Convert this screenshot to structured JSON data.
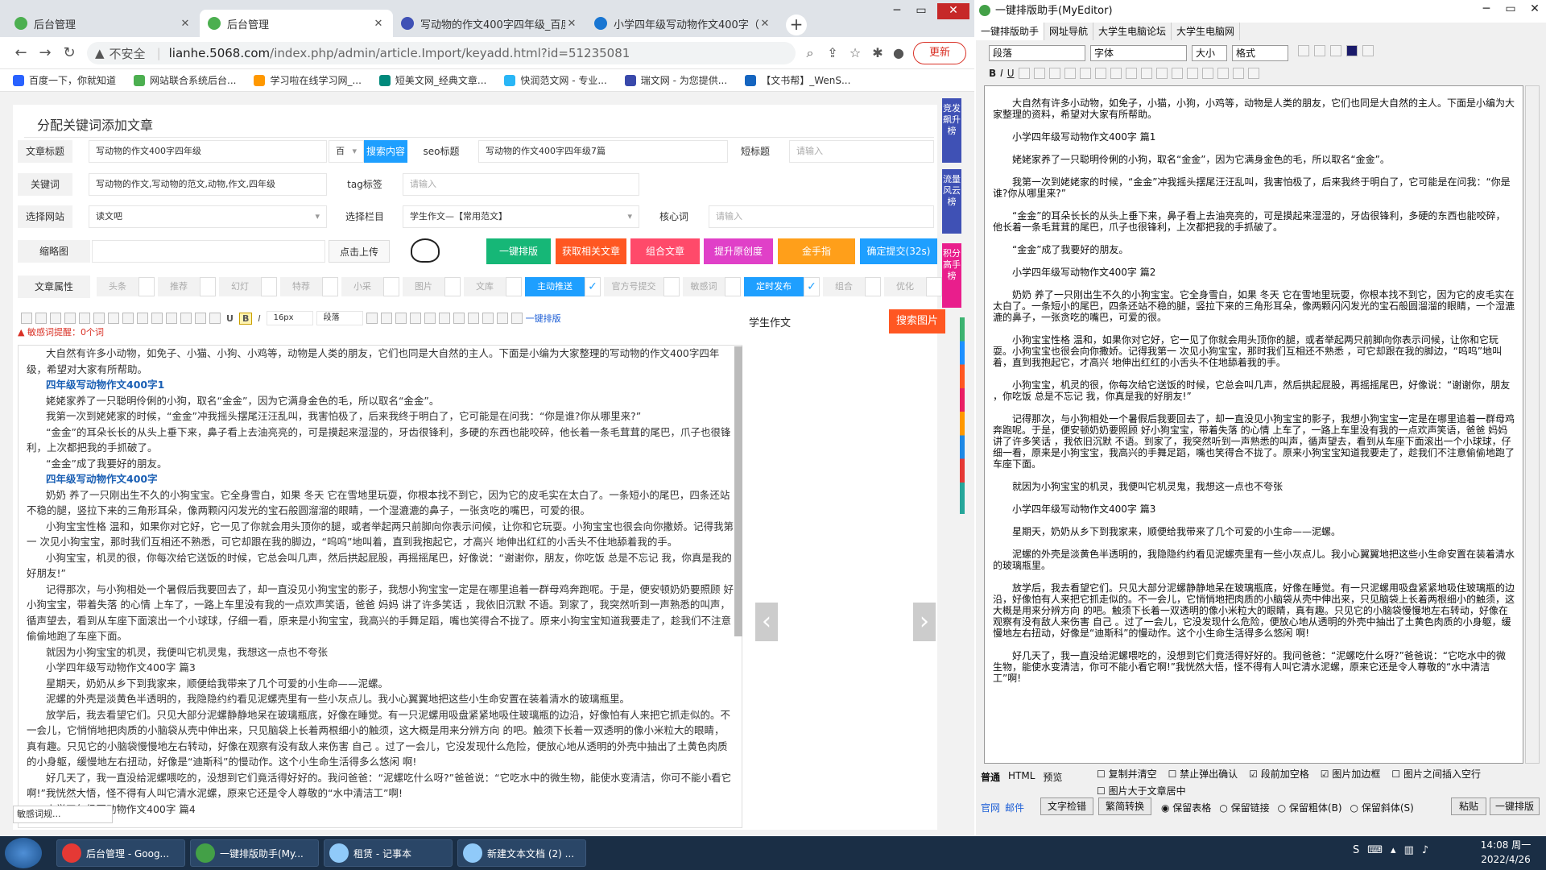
{
  "browser": {
    "tabs": [
      {
        "title": "后台管理",
        "favicon_color": "#4caf50"
      },
      {
        "title": "后台管理",
        "favicon_color": "#4caf50"
      },
      {
        "title": "写动物的作文400字四年级_百度",
        "favicon_color": "#3f51b5"
      },
      {
        "title": "小学四年级写动物作文400字（",
        "favicon_color": "#1976d2"
      }
    ],
    "new_tab": "+",
    "address": {
      "warning": "▲",
      "not_secure": "不安全",
      "host": "lianhe.5068.com",
      "path": "/index.php/admin/article.Import/keyadd.html?id=51235081"
    },
    "update_button": "更新",
    "bookmarks": [
      {
        "label": "百度一下，你就知道",
        "color": "#2962ff"
      },
      {
        "label": "网站联合系统后台...",
        "color": "#4caf50"
      },
      {
        "label": "学习啦在线学习网_...",
        "color": "#ff9800"
      },
      {
        "label": "短美文网_经典文章...",
        "color": "#00897b"
      },
      {
        "label": "快润范文网 - 专业...",
        "color": "#29b6f6"
      },
      {
        "label": "瑞文网 - 为您提供...",
        "color": "#3949ab"
      },
      {
        "label": "【文书帮】_WenS...",
        "color": "#1565c0"
      }
    ]
  },
  "form": {
    "page_title": "分配关键词添加文章",
    "fields": {
      "article_title_label": "文章标题",
      "article_title_value": "写动物的作文400字四年级",
      "article_title_type": "百",
      "search_button": "搜索内容",
      "seo_title_label": "seo标题",
      "seo_title_value": "写动物的作文400字四年级7篇",
      "short_title_label": "短标题",
      "short_title_placeholder": "请输入",
      "keywords_label": "关键词",
      "keywords_value": "写动物的作文,写动物的范文,动物,作文,四年级",
      "tag_label": "tag标签",
      "tag_placeholder": "请输入",
      "site_label": "选择网站",
      "site_value": "读文吧",
      "column_label": "选择栏目",
      "column_value": "学生作文—【常用范文】",
      "core_word_label": "核心词",
      "core_word_placeholder": "请输入",
      "thumbnail_label": "缩略图",
      "upload_button": "点击上传"
    },
    "action_buttons": [
      {
        "label": "一键排版",
        "color": "#16b777"
      },
      {
        "label": "获取相关文章",
        "color": "#ff5722"
      },
      {
        "label": "组合文章",
        "color": "#ff4a6a"
      },
      {
        "label": "提升原创度",
        "color": "#e040c8"
      },
      {
        "label": "金手指",
        "color": "#ff9f1a"
      },
      {
        "label": "确定提交(32s)",
        "color": "#1e9fff"
      }
    ],
    "attributes_label": "文章属性",
    "attributes": [
      {
        "label": "头条",
        "checked": false
      },
      {
        "label": "推荐",
        "checked": false
      },
      {
        "label": "幻灯",
        "checked": false
      },
      {
        "label": "特荐",
        "checked": false
      },
      {
        "label": "小采",
        "checked": false
      },
      {
        "label": "图片",
        "checked": false
      },
      {
        "label": "文库",
        "checked": false
      },
      {
        "label": "主动推送",
        "checked": true
      },
      {
        "label": "官方号提交",
        "checked": false
      },
      {
        "label": "敏感词",
        "checked": false
      },
      {
        "label": "定时发布",
        "checked": true
      },
      {
        "label": "组合",
        "checked": false
      },
      {
        "label": "优化",
        "checked": false
      }
    ]
  },
  "editor": {
    "font_size": "16px",
    "paragraph_format": "段落",
    "one_key_format": "一键排版",
    "sensitive_words": "敏感词提醒：0个词",
    "paragraphs": [
      {
        "text": "大自然有许多小动物，如免子、小猫、小狗、小鸡等，动物是人类的朋友，它们也同是大自然的主人。下面是小编为大家整理的写动物的作文400字四年级，希望对大家有所帮助。",
        "heading": false
      },
      {
        "text": "四年级写动物作文400字1",
        "heading": true
      },
      {
        "text": "姥姥家养了一只聪明伶俐的小狗，取名“金金”，因为它满身金色的毛，所以取名“金金”。",
        "heading": false
      },
      {
        "text": "我第一次到姥姥家的时候，“金金”冲我摇头摆尾汪汪乱叫，我害怕极了，后来我终于明白了，它可能是在问我：“你是谁?你从哪里来?”",
        "heading": false
      },
      {
        "text": "“金金”的耳朵长长的从头上垂下来，鼻子看上去油亮亮的，可是摸起来湿湿的，牙齿很锋利，多硬的东西也能咬碎，他长着一条毛茸茸的尾巴，爪子也很锋利，上次都把我的手抓破了。",
        "heading": false
      },
      {
        "text": "“金金”成了我要好的朋友。",
        "heading": false
      },
      {
        "text": "四年级写动物作文400字",
        "heading": true
      },
      {
        "text": "奶奶 养了一只刚出生不久的小狗宝宝。它全身雪白，如果 冬天 它在雪地里玩耍，你根本找不到它，因为它的皮毛实在太白了。一条短小的尾巴，四条还站不稳的腿，竖拉下来的三角形耳朵，像两颗闪闪发光的宝石般圆溜溜的眼睛，一个湿漉漉的鼻子，一张贪吃的嘴巴，可爱的很。",
        "heading": false
      },
      {
        "text": "小狗宝宝性格 温和，如果你对它好，它一见了你就会用头顶你的腿，或者举起两只前脚向你表示问候，让你和它玩耍。小狗宝宝也很会向你撒娇。记得我第一 次见小狗宝宝，那时我们互相还不熟悉，可它却跟在我的脚边，“呜呜”地叫着，直到我抱起它，才高兴 地伸出红红的小舌头不住地舔着我的手。",
        "heading": false
      },
      {
        "text": "小狗宝宝，机灵的很，你每次给它送饭的时候，它总会叫几声，然后拱起屁股，再摇摇尾巴，好像说：“谢谢你，朋友，你吃饭 总是不忘记 我，你真是我的好朋友!”",
        "heading": false
      },
      {
        "text": "记得那次，与小狗相处一个暑假后我要回去了，却一直没见小狗宝宝的影子，我想小狗宝宝一定是在哪里追着一群母鸡奔跑呢。于是，便安顿奶奶要照顾 好小狗宝宝，带着失落 的心情 上车了，一路上车里没有我的一点欢声笑语，爸爸 妈妈 讲了许多笑话 ，我依旧沉默 不语。到家了，我突然听到一声熟悉的叫声，循声望去，看到从车座下面滚出一个小球球，仔细一看，原来是小狗宝宝，我高兴的手舞足蹈，嘴也笑得合不拢了。原来小狗宝宝知道我要走了，趁我们不注意偷偷地跑了车座下面。",
        "heading": false
      },
      {
        "text": "就因为小狗宝宝的机灵，我便叫它机灵鬼，我想这一点也不夸张",
        "heading": false
      },
      {
        "text": "小学四年级写动物作文400字 篇3",
        "heading": false
      },
      {
        "text": "星期天，奶奶从乡下到我家来，顺便给我带来了几个可爱的小生命——泥螺。",
        "heading": false
      },
      {
        "text": "泥螺的外壳是淡黄色半透明的，我隐隐约约看见泥螺壳里有一些小灰点儿。我小心翼翼地把这些小生命安置在装着清水的玻璃瓶里。",
        "heading": false
      },
      {
        "text": "放学后，我去看望它们。只见大部分泥螺静静地呆在玻璃瓶底，好像在睡觉。有一只泥螺用吸盘紧紧地吸住玻璃瓶的边沿，好像怕有人来把它抓走似的。不一会儿，它悄悄地把肉质的小脑袋从壳中伸出来，只见脑袋上长着两根细小的触须，这大概是用来分辨方向 的吧。触须下长着一双透明的像小米粒大的眼睛，真有趣。只见它的小脑袋慢慢地左右转动，好像在观察有没有敌人来伤害 自己 。过了一会儿，它没发现什么危险，便放心地从透明的外壳中抽出了土黄色肉质的小身躯，缓慢地左右扭动，好像是“迪斯科”的慢动作。这个小生命生活得多么悠闲 啊!",
        "heading": false
      },
      {
        "text": "好几天了，我一直没给泥螺喂吃的，没想到它们竟活得好好的。我问爸爸：“泥螺吃什么呀?”爸爸说：“它吃水中的微生物，能使水变清洁，你可不能小看它啊!”我恍然大悟，怪不得有人叫它清水泥螺，原来它还是令人尊敬的“水中清洁工”啊!",
        "heading": false
      },
      {
        "text": "小学四年级写动物作文400字 篇4",
        "heading": false
      }
    ]
  },
  "side": {
    "title": "学生作文",
    "search_image_button": "搜索图片",
    "prev_arrow": "‹",
    "next_arrow": "›",
    "vertical_tabs": [
      {
        "label": "竞发飙升榜",
        "color": "#3f51b5"
      },
      {
        "label": "流量风云榜",
        "color": "#3f51b5"
      },
      {
        "label": "积分高手榜",
        "color": "#e91e8c"
      }
    ],
    "status_text": "敏感词规..."
  },
  "myeditor": {
    "title": "一键排版助手(MyEditor)",
    "menu": [
      "一键排版助手",
      "网址导航",
      "大学生电脑论坛",
      "大学生电脑网"
    ],
    "combos": {
      "format": "段落",
      "font": "字体",
      "size": "大小",
      "style": "格式"
    },
    "paragraphs": [
      "大自然有许多小动物，如免子，小猫，小狗，小鸡等，动物是人类的朋友，它们也同是大自然的主人。下面是小编为大家整理的资料，希望对大家有所帮助。",
      "小学四年级写动物作文400字 篇1",
      "姥姥家养了一只聪明伶俐的小狗，取名“金金”，因为它满身金色的毛，所以取名“金金”。",
      "我第一次到姥姥家的时候，“金金”冲我摇头摆尾汪汪乱叫，我害怕极了，后来我终于明白了，它可能是在问我：“你是谁?你从哪里来?”",
      "“金金”的耳朵长长的从头上垂下来，鼻子看上去油亮亮的，可是摸起来湿湿的，牙齿很锋利，多硬的东西也能咬碎，他长着一条毛茸茸的尾巴，爪子也很锋利，上次都把我的手抓破了。",
      "“金金”成了我要好的朋友。",
      "小学四年级写动物作文400字 篇2",
      "奶奶 养了一只刚出生不久的小狗宝宝。它全身雪白，如果 冬天 它在雪地里玩耍，你根本找不到它，因为它的皮毛实在太白了。一条短小的尾巴，四条还站不稳的腿，竖拉下来的三角形耳朵，像两颗闪闪发光的宝石般圆溜溜的眼睛，一个湿漉漉的鼻子，一张贪吃的嘴巴，可爱的很。",
      "小狗宝宝性格 温和，如果你对它好，它一见了你就会用头顶你的腿，或者举起两只前脚向你表示问候，让你和它玩耍。小狗宝宝也很会向你撒娇。记得我第一 次见小狗宝宝，那时我们互相还不熟悉 ，可它却跟在我的脚边，“呜呜”地叫着，直到我抱起它，才高兴 地伸出红红的小舌头不住地舔着我的手。",
      "小狗宝宝，机灵的很，你每次给它送饭的时候，它总会叫几声，然后拱起屁股，再摇摇尾巴，好像说：“谢谢你，朋友 ，你吃饭 总是不忘记 我，你真是我的好朋友!”",
      "记得那次，与小狗相处一个暑假后我要回去了，却一直没见小狗宝宝的影子，我想小狗宝宝一定是在哪里追着一群母鸡奔跑呢。于是，便安顿奶奶要照顾 好小狗宝宝，带着失落 的心情 上车了，一路上车里没有我的一点欢声笑语，爸爸 妈妈 讲了许多笑话 ，我依旧沉默 不语。到家了，我突然听到一声熟悉的叫声，循声望去，看到从车座下面滚出一个小球球，仔细一看，原来是小狗宝宝，我高兴的手舞足蹈，嘴也笑得合不拢了。原来小狗宝宝知道我要走了，趁我们不注意偷偷地跑了车座下面。",
      "就因为小狗宝宝的机灵，我便叫它机灵鬼，我想这一点也不夸张",
      "小学四年级写动物作文400字 篇3",
      "星期天，奶奶从乡下到我家来，顺便给我带来了几个可爱的小生命——泥螺。",
      "泥螺的外壳是淡黄色半透明的，我隐隐约约看见泥螺壳里有一些小灰点儿。我小心翼翼地把这些小生命安置在装着清水的玻璃瓶里。",
      "放学后，我去看望它们。只见大部分泥螺静静地呆在玻璃瓶底，好像在睡觉。有一只泥螺用吸盘紧紧地吸住玻璃瓶的边沿，好像怕有人来把它抓走似的。不一会儿，它悄悄地把肉质的小脑袋从壳中伸出来，只见脑袋上长着两根细小的触须，这大概是用来分辨方向 的吧。触须下长着一双透明的像小米粒大的眼睛，真有趣。只见它的小脑袋慢慢地左右转动，好像在观察有没有敌人来伤害 自己 。过了一会儿，它没发现什么危险，便放心地从透明的外壳中抽出了土黄色肉质的小身躯，缓慢地左右扭动，好像是“迪斯科”的慢动作。这个小生命生活得多么悠闲 啊!",
      "好几天了，我一直没给泥螺喂吃的，没想到它们竟活得好好的。我问爸爸：“泥螺吃什么呀?”爸爸说：“它吃水中的微生物，能使水变清洁，你可不能小看它啊!”我恍然大悟，怪不得有人叫它清水泥螺，原来它还是令人尊敬的“水中清洁工”啊!"
    ],
    "bottom": {
      "tabs": [
        "普通",
        "HTML",
        "预览"
      ],
      "checks": [
        {
          "label": "复制并清空",
          "checked": false
        },
        {
          "label": "禁止弹出确认",
          "checked": false
        },
        {
          "label": "段前加空格",
          "checked": true
        },
        {
          "label": "图片加边框",
          "checked": true
        },
        {
          "label": "图片之间插入空行",
          "checked": false
        },
        {
          "label": "图片大于文章居中",
          "checked": false
        }
      ],
      "links": [
        "官网",
        "邮件"
      ],
      "buttons": [
        "文字检错",
        "繁简转换",
        "粘贴",
        "一键排版"
      ],
      "radios": [
        {
          "label": "保留表格",
          "checked": true
        },
        {
          "label": "保留链接",
          "checked": false
        },
        {
          "label": "保留粗体(B)",
          "checked": false
        },
        {
          "label": "保留斜体(S)",
          "checked": false
        }
      ]
    }
  },
  "taskbar": {
    "items": [
      {
        "label": "后台管理 - Goog...",
        "color": "#e53935"
      },
      {
        "label": "一键排版助手(My...",
        "color": "#43a047"
      },
      {
        "label": "租赁 - 记事本",
        "color": "#90caf9"
      },
      {
        "label": "新建文本文档 (2) ...",
        "color": "#90caf9"
      }
    ],
    "time": "14:08 周一",
    "date": "2022/4/26"
  }
}
